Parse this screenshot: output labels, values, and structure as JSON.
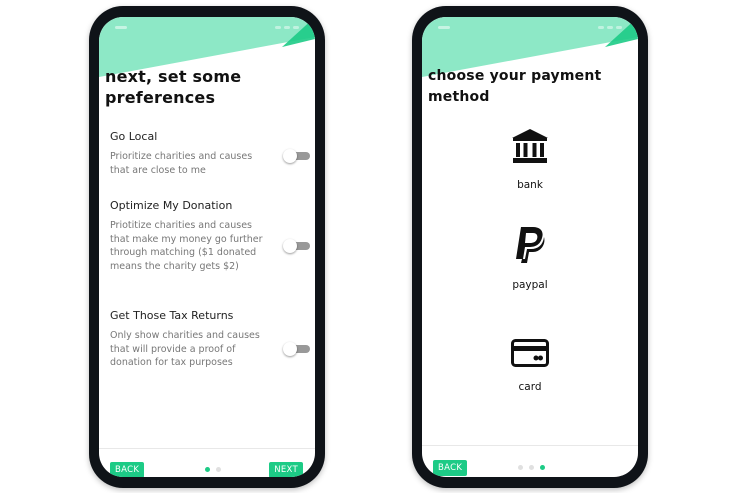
{
  "colors": {
    "accent": "#1dcb86",
    "header_light": "#8de8c6",
    "header_dark": "#1dcb86",
    "frame": "#0f1318"
  },
  "preferences_screen": {
    "title": "next, set some preferences",
    "items": [
      {
        "label": "Go Local",
        "description": "Prioritize charities and causes that are close to me",
        "enabled": false
      },
      {
        "label": "Optimize My Donation",
        "description": "Priotitize charities and causes that make my money go further through matching ($1 donated means the charity gets $2)",
        "enabled": false
      },
      {
        "label": "Get Those Tax Returns",
        "description": "Only show charities and causes that will provide a proof of donation for tax purposes",
        "enabled": false
      }
    ],
    "back_label": "BACK",
    "next_label": "NEXT",
    "page_indicator": {
      "count": 2,
      "active": 0
    }
  },
  "payment_screen": {
    "title": "choose your payment method",
    "options": [
      {
        "label": "bank",
        "icon": "bank-icon"
      },
      {
        "label": "paypal",
        "icon": "paypal-icon"
      },
      {
        "label": "card",
        "icon": "credit-card-icon"
      }
    ],
    "back_label": "BACK",
    "page_indicator": {
      "count": 3,
      "active": 2
    }
  }
}
